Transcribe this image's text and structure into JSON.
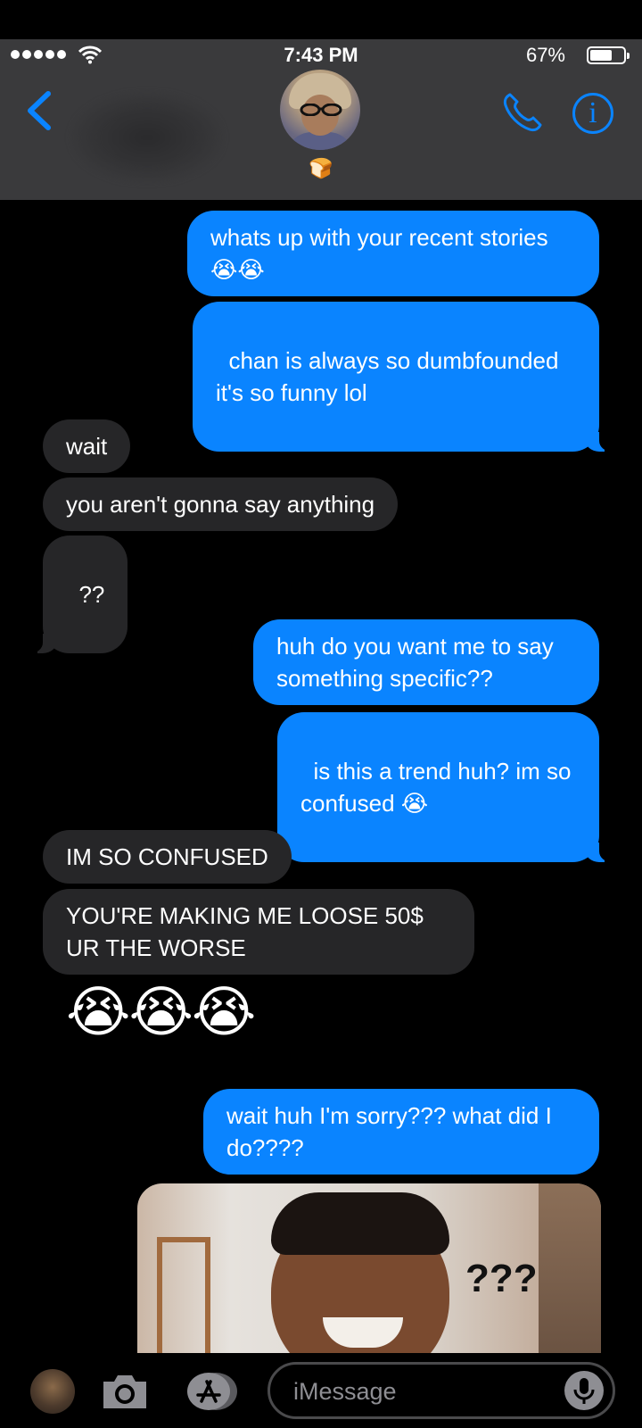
{
  "status_bar": {
    "time": "7:43 PM",
    "battery_percent_text": "67%",
    "battery_level": 0.67
  },
  "header": {
    "contact_status_emoji": "🍞",
    "info_glyph": "i"
  },
  "messages": [
    {
      "from": "me",
      "text": "whats up with your recent stories\n😭😭"
    },
    {
      "from": "me",
      "text": "chan is always so dumbfounded\nit's so funny lol"
    },
    {
      "from": "them",
      "text": "wait"
    },
    {
      "from": "them",
      "text": "you aren't gonna say anything"
    },
    {
      "from": "them",
      "text": "??"
    },
    {
      "from": "me",
      "text": "huh do you want me to say\nsomething specific??"
    },
    {
      "from": "me",
      "text": "is this a trend huh? im so\nconfused 😭"
    },
    {
      "from": "them",
      "text": "IM SO CONFUSED"
    },
    {
      "from": "them",
      "text": "YOU'RE MAKING ME LOOSE 50$\nUR THE WORSE"
    },
    {
      "from": "them",
      "text": "😭😭😭"
    },
    {
      "from": "me",
      "text": "wait huh I'm sorry??? what did I\ndo????"
    }
  ],
  "meme_image": {
    "caption_text": "???"
  },
  "input_bar": {
    "placeholder": "iMessage"
  },
  "colors": {
    "sent_bubble": "#0a84ff",
    "received_bubble": "#262628",
    "header_bg": "#3a3a3c",
    "accent": "#0a84ff"
  }
}
